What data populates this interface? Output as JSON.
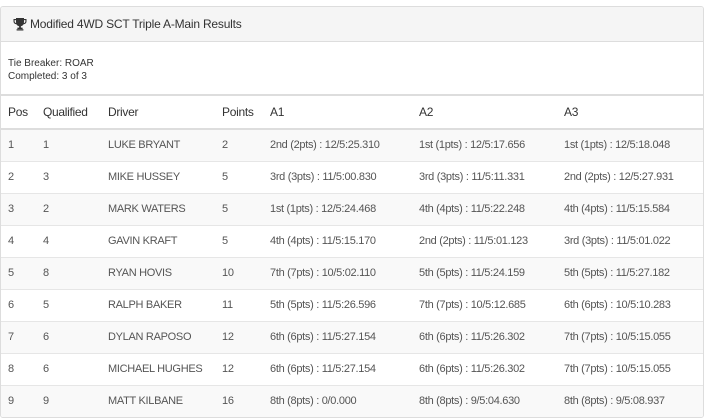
{
  "panel": {
    "title": "Modified 4WD SCT Triple A-Main Results",
    "icon": "trophy-icon"
  },
  "info": {
    "tie_breaker": "Tie Breaker: ROAR",
    "completed": "Completed: 3 of 3"
  },
  "table": {
    "headers": [
      "Pos",
      "Qualified",
      "Driver",
      "Points",
      "A1",
      "A2",
      "A3"
    ],
    "rows": [
      [
        "1",
        "1",
        "LUKE BRYANT",
        "2",
        "2nd (2pts) : 12/5:25.310",
        "1st (1pts) : 12/5:17.656",
        "1st (1pts) : 12/5:18.048"
      ],
      [
        "2",
        "3",
        "MIKE HUSSEY",
        "5",
        "3rd (3pts) : 11/5:00.830",
        "3rd (3pts) : 11/5:11.331",
        "2nd (2pts) : 12/5:27.931"
      ],
      [
        "3",
        "2",
        "MARK WATERS",
        "5",
        "1st (1pts) : 12/5:24.468",
        "4th (4pts) : 11/5:22.248",
        "4th (4pts) : 11/5:15.584"
      ],
      [
        "4",
        "4",
        "GAVIN KRAFT",
        "5",
        "4th (4pts) : 11/5:15.170",
        "2nd (2pts) : 11/5:01.123",
        "3rd (3pts) : 11/5:01.022"
      ],
      [
        "5",
        "8",
        "RYAN HOVIS",
        "10",
        "7th (7pts) : 10/5:02.110",
        "5th (5pts) : 11/5:24.159",
        "5th (5pts) : 11/5:27.182"
      ],
      [
        "6",
        "5",
        "RALPH BAKER",
        "11",
        "5th (5pts) : 11/5:26.596",
        "7th (7pts) : 10/5:12.685",
        "6th (6pts) : 10/5:10.283"
      ],
      [
        "7",
        "6",
        "DYLAN RAPOSO",
        "12",
        "6th (6pts) : 11/5:27.154",
        "6th (6pts) : 11/5:26.302",
        "7th (7pts) : 10/5:15.055"
      ],
      [
        "8",
        "6",
        "MICHAEL HUGHES",
        "12",
        "6th (6pts) : 11/5:27.154",
        "6th (6pts) : 11/5:26.302",
        "7th (7pts) : 10/5:15.055"
      ],
      [
        "9",
        "9",
        "MATT KILBANE",
        "16",
        "8th (8pts) : 0/0.000",
        "8th (8pts) : 9/5:04.630",
        "8th (8pts) : 9/5:08.937"
      ]
    ]
  }
}
